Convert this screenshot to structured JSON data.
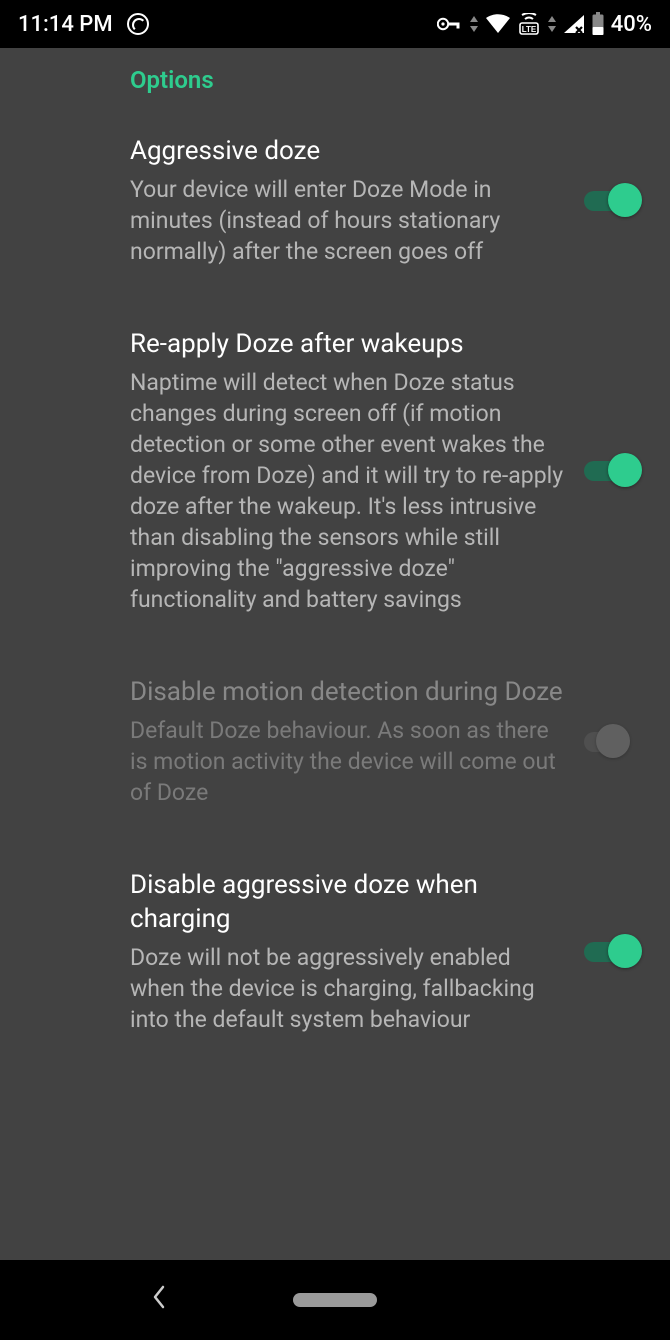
{
  "status": {
    "time": "11:14 PM",
    "battery_pct": "40%"
  },
  "section_header": "Options",
  "settings": [
    {
      "key": "aggressive-doze",
      "title": "Aggressive doze",
      "desc": "Your device will enter Doze Mode in minutes (instead of hours stationary normally) after the screen goes off",
      "enabled": true,
      "on": true
    },
    {
      "key": "reapply-doze",
      "title": "Re-apply Doze after wakeups",
      "desc": "Naptime will detect when Doze status changes during screen off (if motion detection or some other event wakes the device from Doze) and it will try to re-apply doze after the wakeup. It's less intrusive than disabling the sensors while still improving the \"aggressive doze\" functionality and battery savings",
      "enabled": true,
      "on": true
    },
    {
      "key": "disable-motion",
      "title": "Disable motion detection during Doze",
      "desc": "Default Doze behaviour. As soon as there is motion activity the device will come out of Doze",
      "enabled": false,
      "on": false
    },
    {
      "key": "disable-aggressive-charging",
      "title": "Disable aggressive doze when charging",
      "desc": "Doze will not be aggressively enabled when the device is charging, fallbacking into the default system behaviour",
      "enabled": true,
      "on": true
    }
  ]
}
